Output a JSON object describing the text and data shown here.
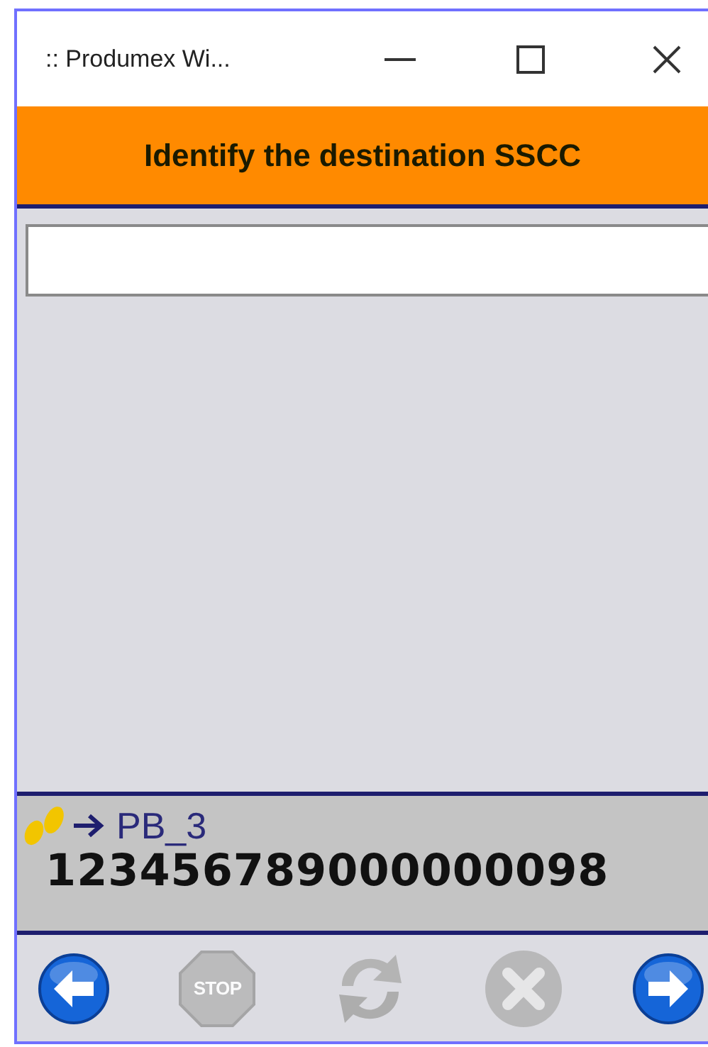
{
  "window": {
    "title": ":: Produmex Wi..."
  },
  "header": {
    "title": "Identify the destination SSCC"
  },
  "info": {
    "location": "PB_3",
    "sscc": "123456789000000098"
  },
  "toolbar": [
    {
      "kind": "back",
      "disabled": false
    },
    {
      "kind": "stop",
      "label": "STOP",
      "disabled": true
    },
    {
      "kind": "refresh",
      "disabled": true
    },
    {
      "kind": "cancel",
      "disabled": true
    },
    {
      "kind": "next",
      "disabled": false
    }
  ]
}
